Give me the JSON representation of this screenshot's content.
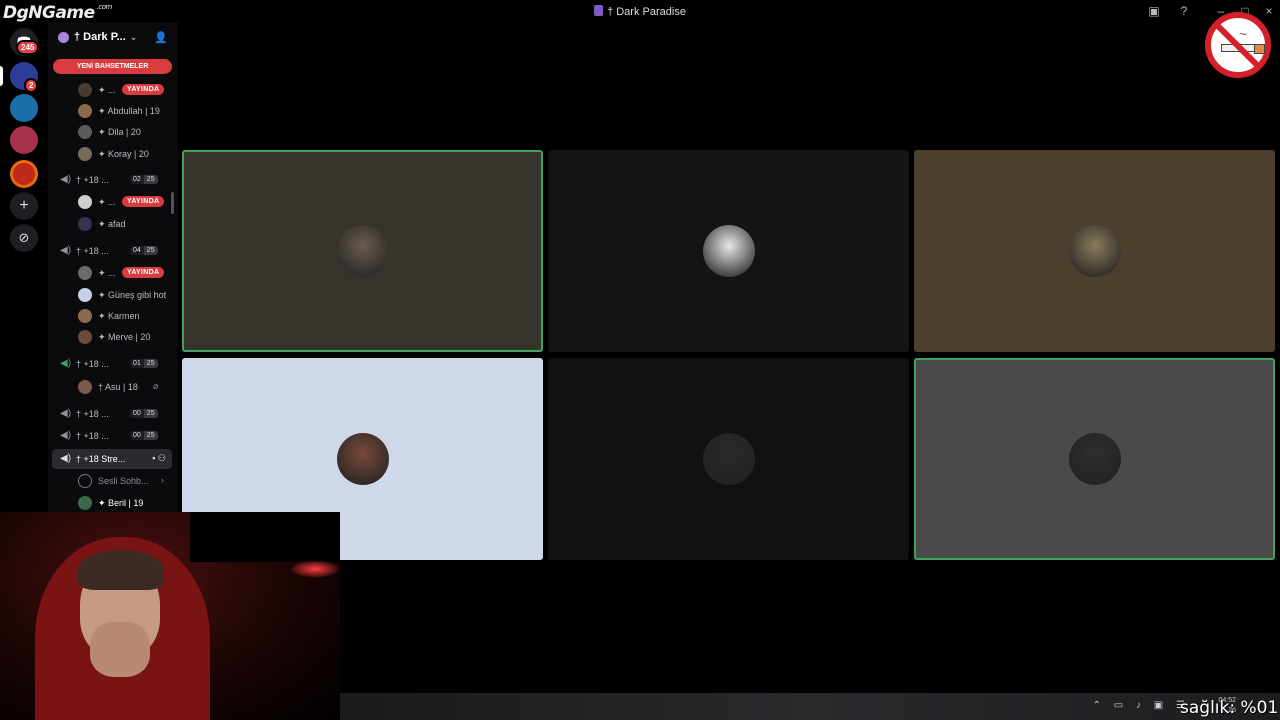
{
  "watermark": {
    "text": "DgNGame",
    "small": ".com"
  },
  "window": {
    "title": "† Dark Paradise"
  },
  "server_rail": {
    "home_badge": "245",
    "server2_badge": "2"
  },
  "server_header": {
    "name": "† Dark P..."
  },
  "new_mentions": "YENİ BAHSETMELER",
  "channel_list": [
    {
      "kind": "user",
      "name": "✦ ...",
      "live": "YAYINDA",
      "color": "#4a3a32"
    },
    {
      "kind": "user",
      "name": "✦ Abdullah | 19",
      "color": "#8a6a4a"
    },
    {
      "kind": "user",
      "name": "✦ Dila | 20",
      "color": "#5a5a5a"
    },
    {
      "kind": "user",
      "name": "✦ Koray | 20",
      "color": "#7a6a5a"
    },
    {
      "kind": "voice",
      "name": "† +18 ...",
      "a": "02",
      "b": "25"
    },
    {
      "kind": "user",
      "name": "✦ ...",
      "live": "YAYINDA",
      "color": "#cfcfcf"
    },
    {
      "kind": "user",
      "name": "✦ afad",
      "color": "#3a3050"
    },
    {
      "kind": "voice",
      "name": "† +18 ...",
      "a": "04",
      "b": "25"
    },
    {
      "kind": "user",
      "name": "✦ ...",
      "live": "YAYINDA",
      "color": "#6a6a6a"
    },
    {
      "kind": "user",
      "name": "✦ Güneş gibi hot",
      "color": "#c8d0e8"
    },
    {
      "kind": "user",
      "name": "✦ Karmen",
      "color": "#8a6a50"
    },
    {
      "kind": "user",
      "name": "✦ Merve | 20",
      "color": "#6a4a3a"
    },
    {
      "kind": "voice",
      "name": "† +18 ...",
      "a": "01",
      "b": "25",
      "green": true
    },
    {
      "kind": "user",
      "name": "† Asu | 18",
      "color": "#7a5a4a",
      "mute": true
    },
    {
      "kind": "voice",
      "name": "† +18 ...",
      "a": "00",
      "b": "25"
    },
    {
      "kind": "voice",
      "name": "† +18 ...",
      "a": "00",
      "b": "25"
    },
    {
      "kind": "voice",
      "name": "† +18 Stre...",
      "active": true
    },
    {
      "kind": "activity",
      "name": "Sesli Sohb..."
    },
    {
      "kind": "user",
      "name": "✦ Beril | 19",
      "color": "#3a6a4a",
      "bright": true
    }
  ],
  "video_tiles": [
    {
      "name": "participant-1",
      "bg": "#36322c",
      "avatar": "#6a5c50",
      "speaking": true
    },
    {
      "name": "participant-2",
      "bg": "#141414",
      "avatar": "#e8e8e8",
      "speaking": false
    },
    {
      "name": "participant-3",
      "bg": "#4c3f2e",
      "avatar": "#8a7a5a",
      "speaking": false
    },
    {
      "name": "participant-4",
      "bg": "#cfd8e8",
      "avatar": "#7a4a3a",
      "speaking": false
    },
    {
      "name": "participant-5",
      "bg": "#111111",
      "avatar": "#2a2a2a",
      "speaking": false
    },
    {
      "name": "participant-6",
      "bg": "#4a4a4a",
      "avatar": "#2e2e2e",
      "speaking": true
    }
  ],
  "taskbar": {
    "time": "04:52",
    "date": "...26"
  },
  "overlay": {
    "health": "sağlık: %01"
  }
}
